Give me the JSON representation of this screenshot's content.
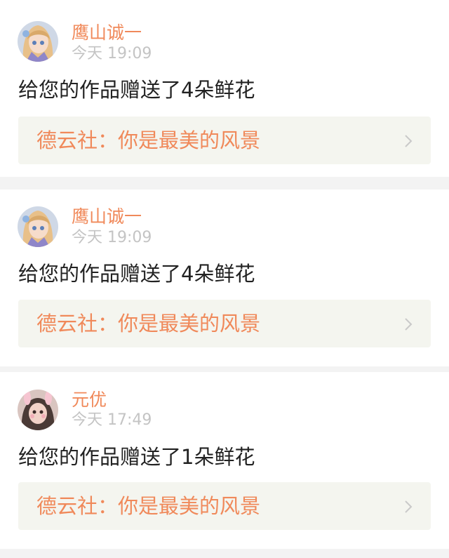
{
  "notifications": [
    {
      "username": "鹰山诚一",
      "time": "今天 19:09",
      "message": "给您的作品赠送了4朵鲜花",
      "work_title": "德云社：你是最美的风景",
      "avatar_icon": "anime-girl-avatar"
    },
    {
      "username": "鹰山诚一",
      "time": "今天 19:09",
      "message": "给您的作品赠送了4朵鲜花",
      "work_title": "德云社：你是最美的风景",
      "avatar_icon": "anime-girl-avatar"
    },
    {
      "username": "元优",
      "time": "今天 17:49",
      "message": "给您的作品赠送了1朵鲜花",
      "work_title": "德云社：你是最美的风景",
      "avatar_icon": "selfie-bunny-filter-avatar"
    }
  ],
  "colors": {
    "accent": "#f0895a",
    "page_background": "#f3f3f3",
    "card_background": "#ffffff",
    "link_background": "#f4f5ef",
    "timestamp": "#c4c4c4",
    "body_text": "#222222",
    "chevron": "#c9c9c9"
  }
}
